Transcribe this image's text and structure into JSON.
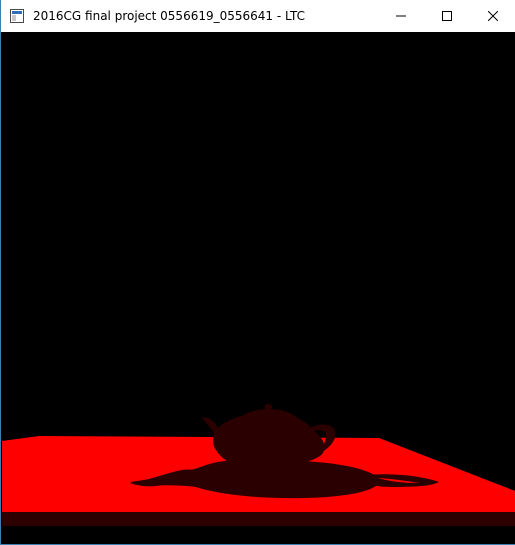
{
  "window": {
    "title": "2016CG final project 0556619_0556641 - LTC",
    "controls": {
      "minimize": "minimize-icon",
      "maximize": "maximize-icon",
      "close": "close-icon"
    }
  },
  "scene": {
    "background_color": "#000000",
    "plane_color": "#ff0000",
    "plane_edge_color": "#2d0000",
    "teapot_color": "#2b0000",
    "shadow_color": "#2b0000"
  }
}
